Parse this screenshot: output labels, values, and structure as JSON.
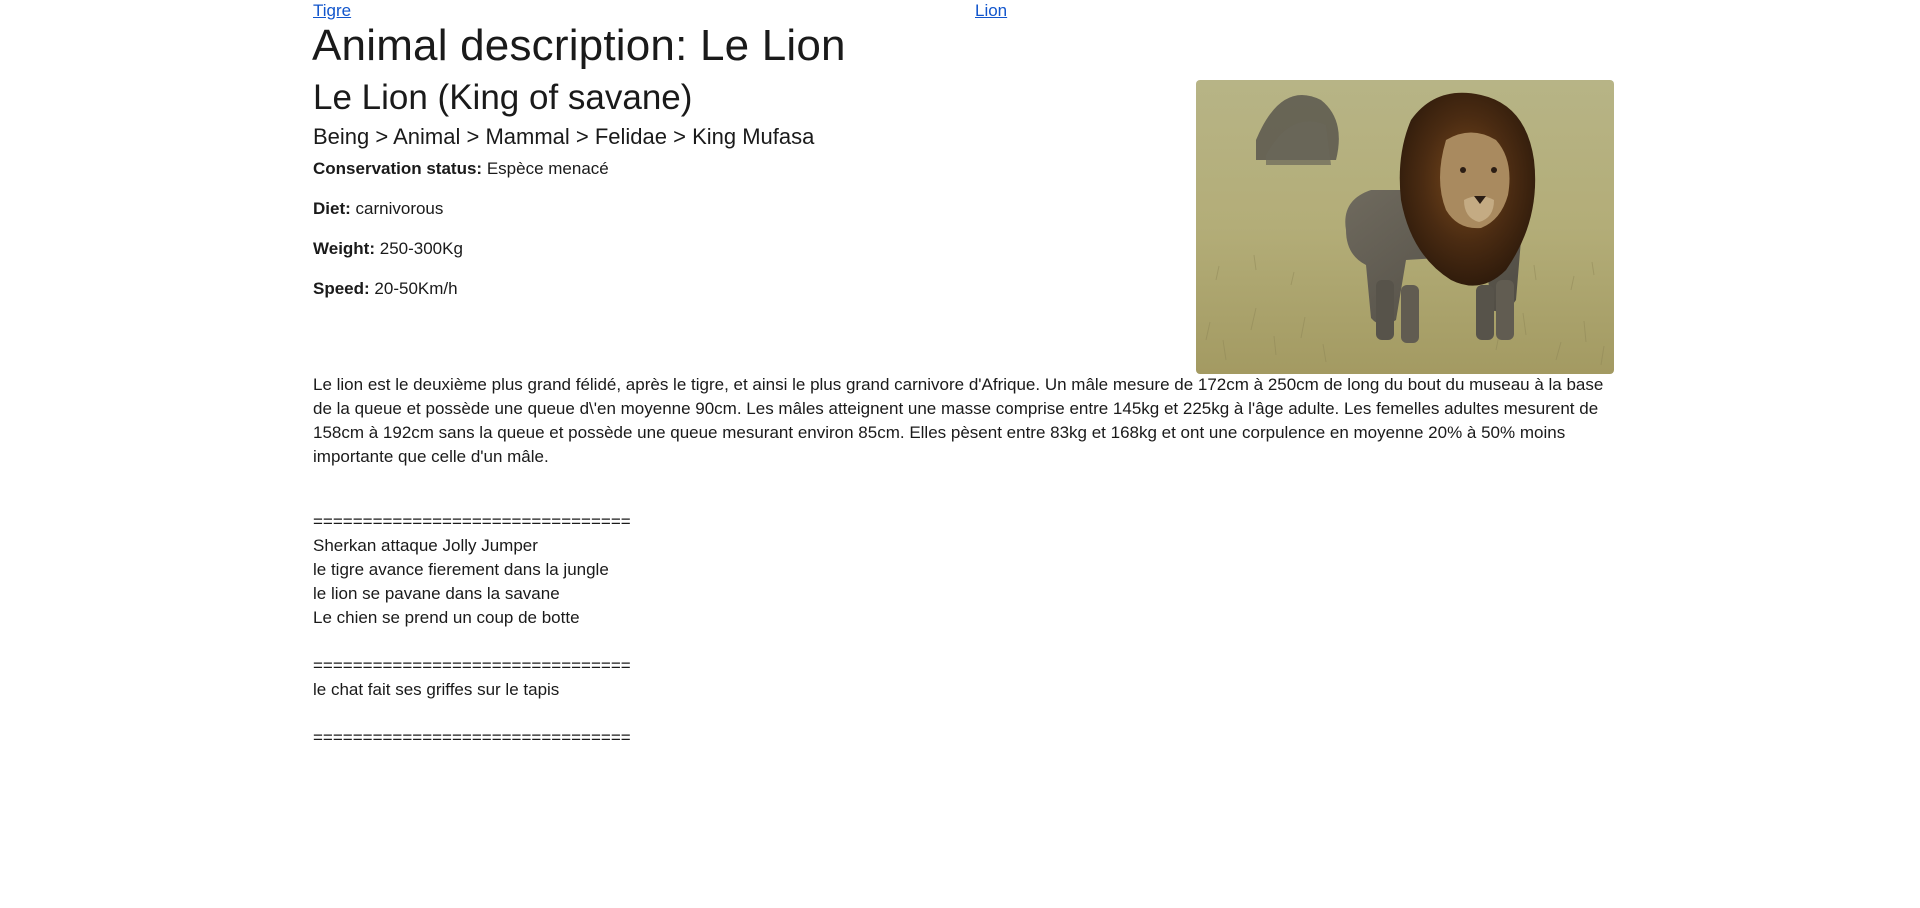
{
  "nav": {
    "link_left": "Tigre",
    "link_right": "Lion"
  },
  "page_title": "Animal description: Le Lion",
  "animal": {
    "subtitle": "Le Lion (King of savane)",
    "taxonomy": "Being > Animal > Mammal > Felidae > King Mufasa",
    "facts": {
      "conservation_label": "Conservation status:",
      "conservation_value": "Espèce menacé",
      "diet_label": "Diet:",
      "diet_value": "carnivorous",
      "weight_label": "Weight:",
      "weight_value": "250-300Kg",
      "speed_label": "Speed:",
      "speed_value": "20-50Km/h"
    },
    "description": "Le lion est le deuxième plus grand félidé, après le tigre, et ainsi le plus grand carnivore d'Afrique. Un mâle mesure de 172cm à 250cm de long du bout du museau à la base de la queue et possède une queue d\\'en moyenne 90cm. Les mâles atteignent une masse comprise entre 145kg et 225kg à l'âge adulte. Les femelles adultes mesurent de 158cm à 192cm sans la queue et possède une queue mesurant environ 85cm. Elles pèsent entre 83kg et 168kg et ont une corpulence en moyenne 20% à 50% moins importante que celle d'un mâle."
  },
  "texts": {
    "separator": "================================",
    "line1": "Sherkan attaque Jolly Jumper",
    "line2": "le tigre avance fierement dans la jungle",
    "line3": "le lion se pavane dans la savane",
    "line4": "Le chien se prend un coup de botte",
    "line5": "le chat fait ses griffes sur le tapis"
  },
  "colors": {
    "link": "#1155cc",
    "text": "#1a1a1a"
  }
}
